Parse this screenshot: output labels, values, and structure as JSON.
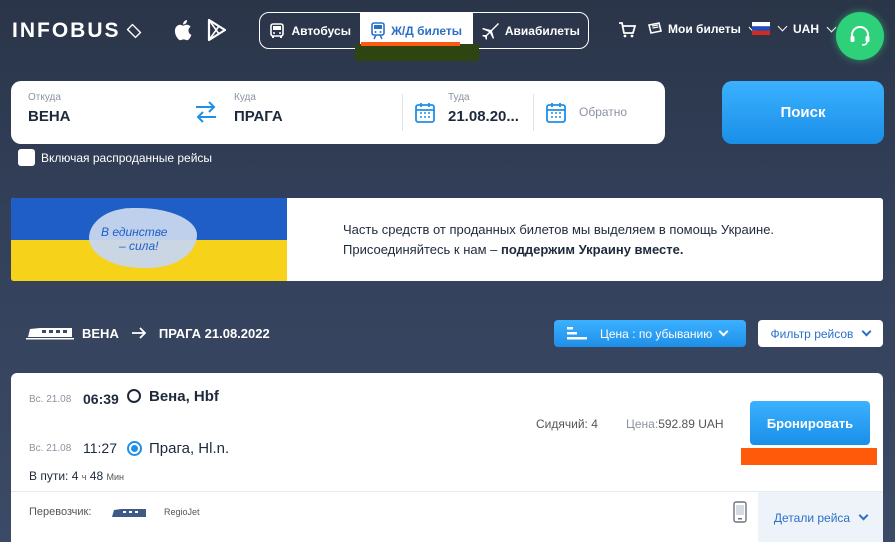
{
  "header": {
    "logo": "INFOBUS",
    "tabs": [
      {
        "label": "Автобусы"
      },
      {
        "label": "Ж/Д билеты"
      },
      {
        "label": "Авиабилеты"
      }
    ],
    "my_tickets": "Мои билеты",
    "currency": "UAH"
  },
  "search": {
    "from_label": "Откуда",
    "from_value": "ВЕНА",
    "to_label": "Куда",
    "to_value": "ПРАГА",
    "date_label": "Туда",
    "date_value": "21.08.20...",
    "return_placeholder": "Обратно",
    "search_button": "Поиск",
    "include_soldout": "Включая распроданные рейсы"
  },
  "banner": {
    "slogan_line1": "В единстве",
    "slogan_line2": "– сила!",
    "text_line1": "Часть средств от проданных билетов мы выделяем в помощь Украине.",
    "text_line2_plain": "Присоединяйтесь к нам – ",
    "text_line2_bold": "поддержим Украину вместе."
  },
  "results_header": {
    "from": "ВЕНА",
    "to_date": "ПРАГА 21.08.2022",
    "sort_label": "Цена : по убыванию",
    "filter_label": "Фильтр рейсов"
  },
  "trip": {
    "dep_date": "Вс. 21.08",
    "dep_time": "06:39",
    "dep_station": "Вена, Hbf",
    "arr_date": "Вс. 21.08",
    "arr_time": "11:27",
    "arr_station": "Прага, Hl.n.",
    "travel_label": "В пути:",
    "travel_hours": "4",
    "travel_hours_unit": "ч",
    "travel_minutes": "48",
    "travel_minutes_unit": "Мин",
    "seats": "Сидячий: 4",
    "price_label": "Цена:",
    "price_value": "592.89 UAH",
    "book_button": "Бронировать",
    "carrier_label": "Перевозчик:",
    "carrier_name": "RegioJet",
    "details_button": "Детали рейса"
  },
  "colors": {
    "accent_blue": "#1f8fe8",
    "highlight_orange": "#ff5a0a",
    "support_green": "#2ed17a",
    "flag_blue": "#1f5ec6",
    "flag_yellow": "#f6d21a"
  }
}
